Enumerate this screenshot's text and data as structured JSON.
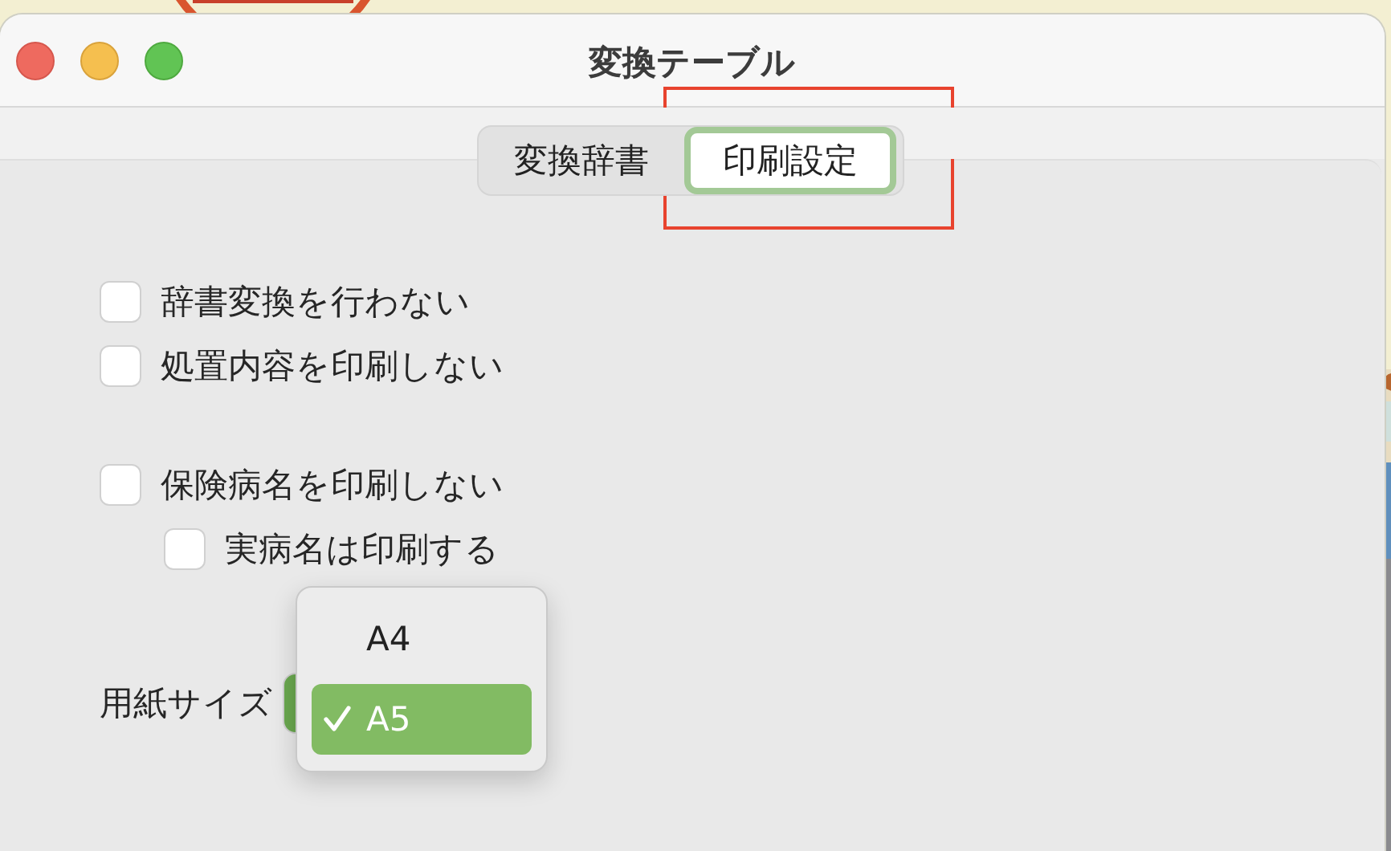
{
  "window": {
    "title": "変換テーブル"
  },
  "tabs": [
    {
      "label": "変換辞書",
      "selected": false
    },
    {
      "label": "印刷設定",
      "selected": true
    }
  ],
  "option_groups": [
    {
      "options": [
        {
          "label": "辞書変換を行わない",
          "checked": false
        },
        {
          "label": "処置内容を印刷しない",
          "checked": false
        }
      ]
    },
    {
      "options": [
        {
          "label": "保険病名を印刷しない",
          "checked": false,
          "children": [
            {
              "label": "実病名は印刷する",
              "checked": false
            }
          ]
        }
      ]
    }
  ],
  "paper_size": {
    "label": "用紙サイズ",
    "menu": [
      {
        "label": "A4",
        "selected": false
      },
      {
        "label": "A5",
        "selected": true
      }
    ]
  }
}
